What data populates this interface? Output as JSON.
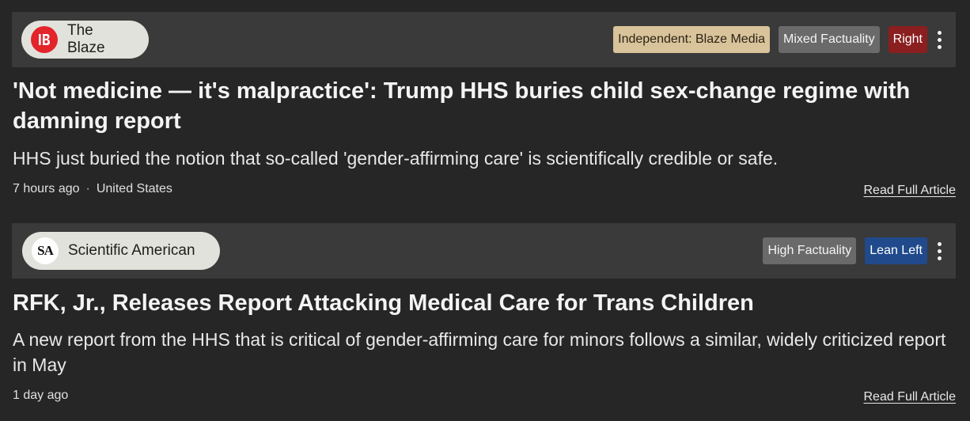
{
  "articles": [
    {
      "source": {
        "name": "The Blaze",
        "logo_icon": "the-blaze-logo-icon",
        "logo_color": "#e3242b"
      },
      "badges": {
        "owner": "Independent: Blaze Media",
        "factuality": "Mixed Factuality",
        "bias": "Right"
      },
      "headline": "'Not medicine — it's malpractice': Trump HHS buries child sex-change regime with damning report",
      "summary": "HHS just buried the notion that so-called 'gender-affirming care' is scientifically credible or safe.",
      "time": "7 hours ago",
      "separator": "·",
      "location": "United States",
      "read_link": "Read Full Article"
    },
    {
      "source": {
        "name": "Scientific American",
        "logo_text": "SA",
        "logo_icon": "scientific-american-logo-icon"
      },
      "badges": {
        "factuality": "High Factuality",
        "bias": "Lean Left"
      },
      "headline": "RFK, Jr., Releases Report Attacking Medical Care for Trans Children",
      "summary": "A new report from the HHS that is critical of gender-affirming care for minors follows a similar, widely criticized report in May",
      "time": "1 day ago",
      "read_link": "Read Full Article"
    }
  ],
  "colors": {
    "page_background": "#262626",
    "source_bar": "#3a3a3a",
    "owner_badge": "#d9c39a",
    "factuality_badge": "#6a6a6a",
    "right_badge": "#8b1e1f",
    "lean_left_badge": "#204a8c"
  }
}
